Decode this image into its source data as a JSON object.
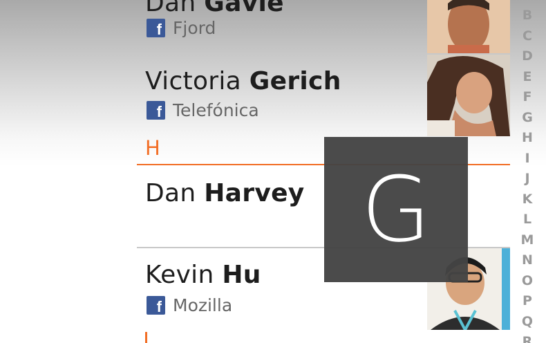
{
  "contacts": [
    {
      "first": "Dan",
      "last": "Gavie",
      "org": "Fjord",
      "has_facebook": true,
      "has_photo": true
    },
    {
      "first": "Victoria",
      "last": "Gerich",
      "org": "Telefónica",
      "has_facebook": true,
      "has_photo": true
    },
    {
      "first": "Dan",
      "last": "Harvey",
      "org": "",
      "has_facebook": false,
      "has_photo": false
    },
    {
      "first": "Kevin",
      "last": "Hu",
      "org": "Mozilla",
      "has_facebook": true,
      "has_photo": true
    }
  ],
  "facebook_glyph": "f",
  "sections": {
    "current": "H"
  },
  "overlay_letter": "G",
  "index_letters": [
    "B",
    "C",
    "D",
    "E",
    "F",
    "G",
    "H",
    "I",
    "J",
    "K",
    "L",
    "M",
    "N",
    "O",
    "P",
    "Q",
    "R"
  ],
  "colors": {
    "accent": "#f26d24",
    "facebook": "#3b5998",
    "overlay": "#444444"
  }
}
